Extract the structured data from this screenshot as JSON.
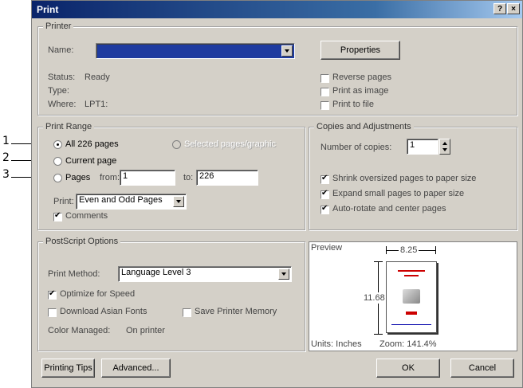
{
  "callouts": [
    "1",
    "2",
    "3"
  ],
  "title": "Print",
  "titlebar": {
    "help": "?",
    "close": "×"
  },
  "printer": {
    "legend": "Printer",
    "name_label": "Name:",
    "properties": "Properties",
    "status_label": "Status:",
    "status_value": "Ready",
    "type_label": "Type:",
    "where_label": "Where:",
    "where_value": "LPT1:",
    "reverse_pages": "Reverse pages",
    "print_as_image": "Print as image",
    "print_to_file": "Print to file"
  },
  "print_range": {
    "legend": "Print Range",
    "all_pages": "All 226 pages",
    "selected": "Selected pages/graphic",
    "current_page": "Current page",
    "pages": "Pages",
    "from_label": "from:",
    "from_value": "1",
    "to_label": "to:",
    "to_value": "226",
    "print_label": "Print:",
    "print_value": "Even and Odd Pages",
    "comments": "Comments"
  },
  "copies": {
    "legend": "Copies and Adjustments",
    "number_label": "Number of copies:",
    "number_value": "1",
    "shrink": "Shrink oversized pages to paper size",
    "expand": "Expand small pages to paper size",
    "autorotate": "Auto-rotate and center pages"
  },
  "postscript": {
    "legend": "PostScript Options",
    "method_label": "Print Method:",
    "method_value": "Language Level 3",
    "optimize": "Optimize for Speed",
    "download_fonts": "Download Asian Fonts",
    "save_memory": "Save Printer Memory",
    "color_label": "Color Managed:",
    "color_value": "On printer"
  },
  "preview": {
    "legend": "Preview",
    "width": "8.25",
    "height": "11.68",
    "units": "Units: Inches",
    "zoom": "Zoom: 141.4%"
  },
  "buttons": {
    "tips": "Printing Tips",
    "advanced": "Advanced...",
    "ok": "OK",
    "cancel": "Cancel"
  }
}
